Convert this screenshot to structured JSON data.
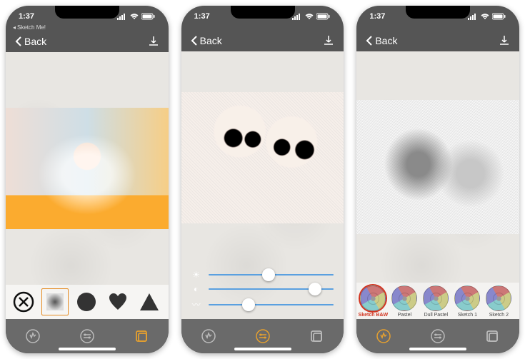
{
  "status": {
    "time": "1:37"
  },
  "breadcrumb": {
    "app": "Sketch Me!"
  },
  "nav": {
    "back_label": "Back"
  },
  "screens": [
    {
      "shapes": [
        "x-circle",
        "soft-square",
        "circle",
        "heart",
        "triangle"
      ],
      "selected_shape_index": 1,
      "active_tool_index": 2
    },
    {
      "sliders": [
        {
          "icon": "brightness",
          "value": 0.48
        },
        {
          "icon": "contrast",
          "value": 0.85
        },
        {
          "icon": "wave",
          "value": 0.32
        }
      ],
      "active_tool_index": 1
    },
    {
      "filters": [
        {
          "label": "Sketch B&W",
          "selected": true
        },
        {
          "label": "Pastel"
        },
        {
          "label": "Dull Pastel"
        },
        {
          "label": "Sketch 1"
        },
        {
          "label": "Sketch 2"
        }
      ],
      "active_tool_index": 0
    }
  ],
  "toolbar": {
    "tools": [
      "effects",
      "adjust",
      "frames"
    ]
  }
}
